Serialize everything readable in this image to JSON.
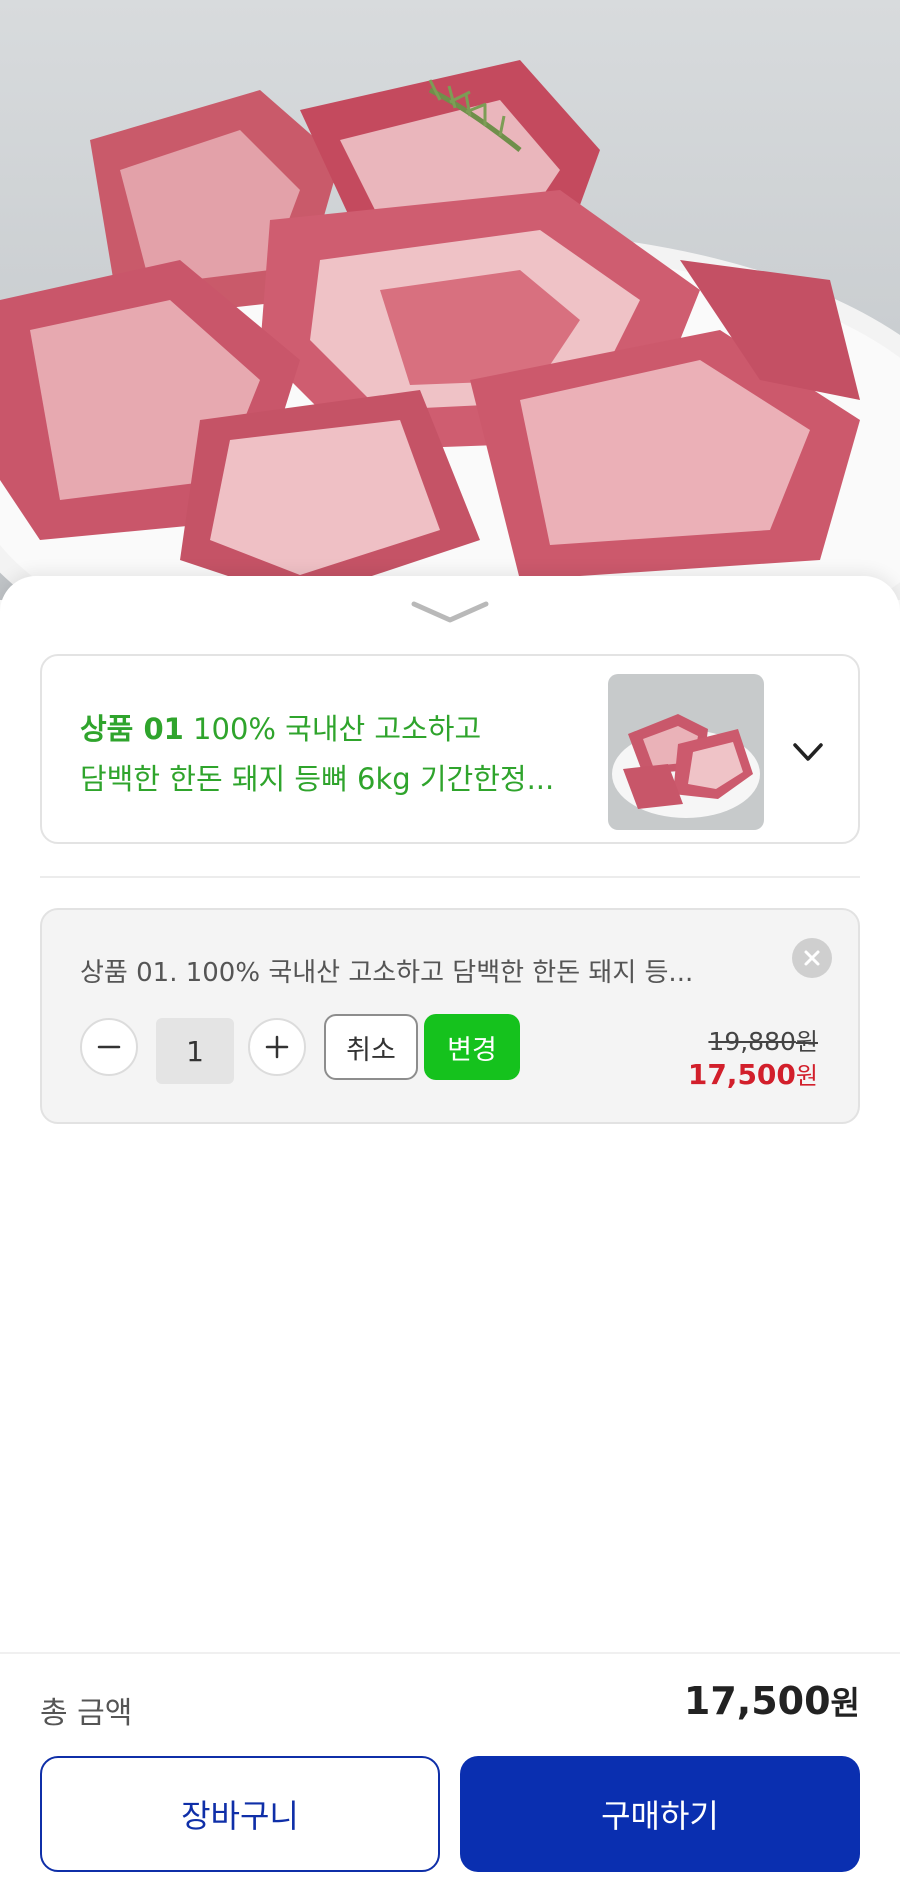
{
  "hero": {
    "image": "pork-neck-bone-photo"
  },
  "sheet": {
    "handle_icon": "chevron-down-icon",
    "product_select": {
      "prefix": "상품 01",
      "line1_rest": " 100% 국내산 고소하고",
      "line2": "담백한 한돈 돼지 등뼈 6kg 기간한정...",
      "thumb": "pork-neck-bone-thumbnail",
      "chevron_icon": "chevron-down-icon"
    },
    "selected_option": {
      "name": "상품 01. 100% 국내산 고소하고 담백한 한돈 돼지 등...",
      "quantity": "1",
      "minus_label": "−",
      "plus_label": "+",
      "cancel_label": "취소",
      "change_label": "변경",
      "original_price": "19,880",
      "original_unit": "원",
      "sale_price": "17,500",
      "sale_unit": "원"
    }
  },
  "footer": {
    "total_label": "총 금액",
    "total_value": "17,500",
    "total_unit": "원",
    "cart_label": "장바구니",
    "buy_label": "구매하기"
  },
  "colors": {
    "accent_green": "#15c21d",
    "title_green": "#2fa42c",
    "sale_red": "#d21f2b",
    "primary_blue": "#0a2fb0"
  }
}
